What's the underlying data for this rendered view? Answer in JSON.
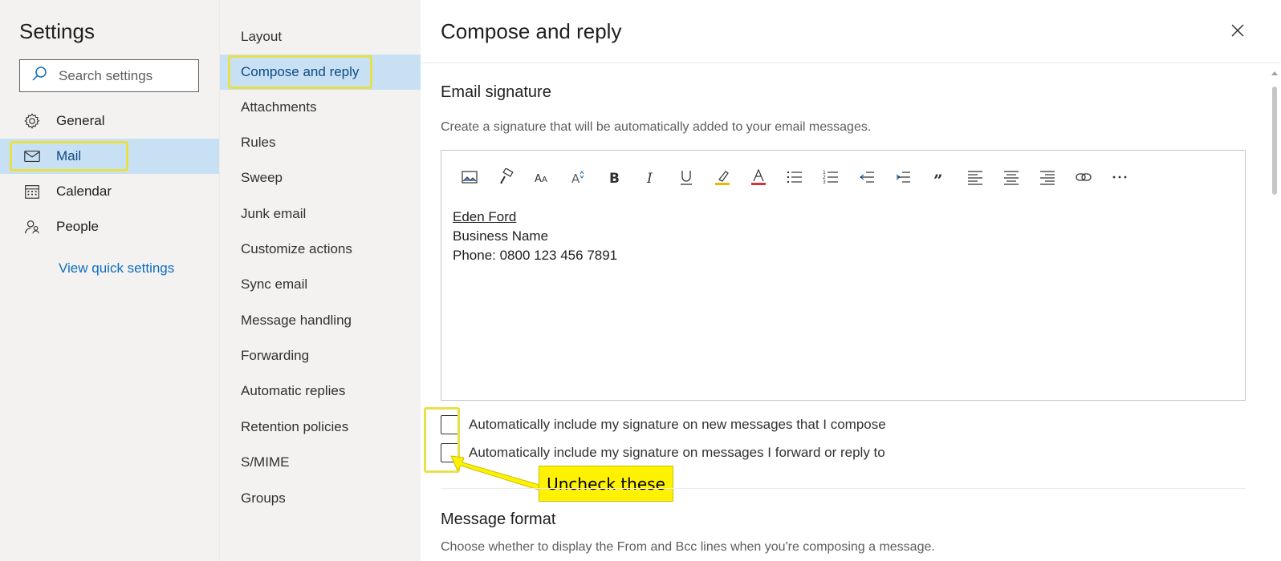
{
  "sidebar": {
    "title": "Settings",
    "search_placeholder": "Search settings",
    "items": [
      {
        "label": "General",
        "icon": "gear-icon"
      },
      {
        "label": "Mail",
        "icon": "mail-icon"
      },
      {
        "label": "Calendar",
        "icon": "calendar-icon"
      },
      {
        "label": "People",
        "icon": "people-icon"
      }
    ],
    "selected": "Mail",
    "quick_settings_link": "View quick settings"
  },
  "submenu": {
    "items": [
      "Layout",
      "Compose and reply",
      "Attachments",
      "Rules",
      "Sweep",
      "Junk email",
      "Customize actions",
      "Sync email",
      "Message handling",
      "Forwarding",
      "Automatic replies",
      "Retention policies",
      "S/MIME",
      "Groups"
    ],
    "selected": "Compose and reply"
  },
  "main": {
    "title": "Compose and reply",
    "email_signature": {
      "heading": "Email signature",
      "description": "Create a signature that will be automatically added to your email messages.",
      "toolbar_icons": [
        "insert-picture-icon",
        "format-painter-icon",
        "font-icon",
        "font-size-icon",
        "bold-icon",
        "italic-icon",
        "underline-icon",
        "highlight-icon",
        "font-color-icon",
        "bullets-icon",
        "numbering-icon",
        "decrease-indent-icon",
        "increase-indent-icon",
        "quote-icon",
        "align-left-icon",
        "align-center-icon",
        "align-right-icon",
        "link-icon",
        "more-options-icon"
      ],
      "signature": {
        "name": "Eden Ford",
        "business": "Business Name",
        "phone": "Phone: 0800 123 456 7891"
      },
      "checkbox_new": {
        "label": "Automatically include my signature on new messages that I compose",
        "checked": false
      },
      "checkbox_reply": {
        "label": "Automatically include my signature on messages I forward or reply to",
        "checked": false
      }
    },
    "message_format": {
      "heading": "Message format",
      "description": "Choose whether to display the From and Bcc lines when you're composing a message."
    }
  },
  "annotation": {
    "callout_text": "Uncheck these",
    "highlight_color": "#e8e04a",
    "callout_color": "#fff200"
  },
  "colors": {
    "selected_bg": "#c7e0f4",
    "selected_text": "#0f4a85",
    "link": "#0f6cbd",
    "pane_bg": "#f3f2f1"
  }
}
